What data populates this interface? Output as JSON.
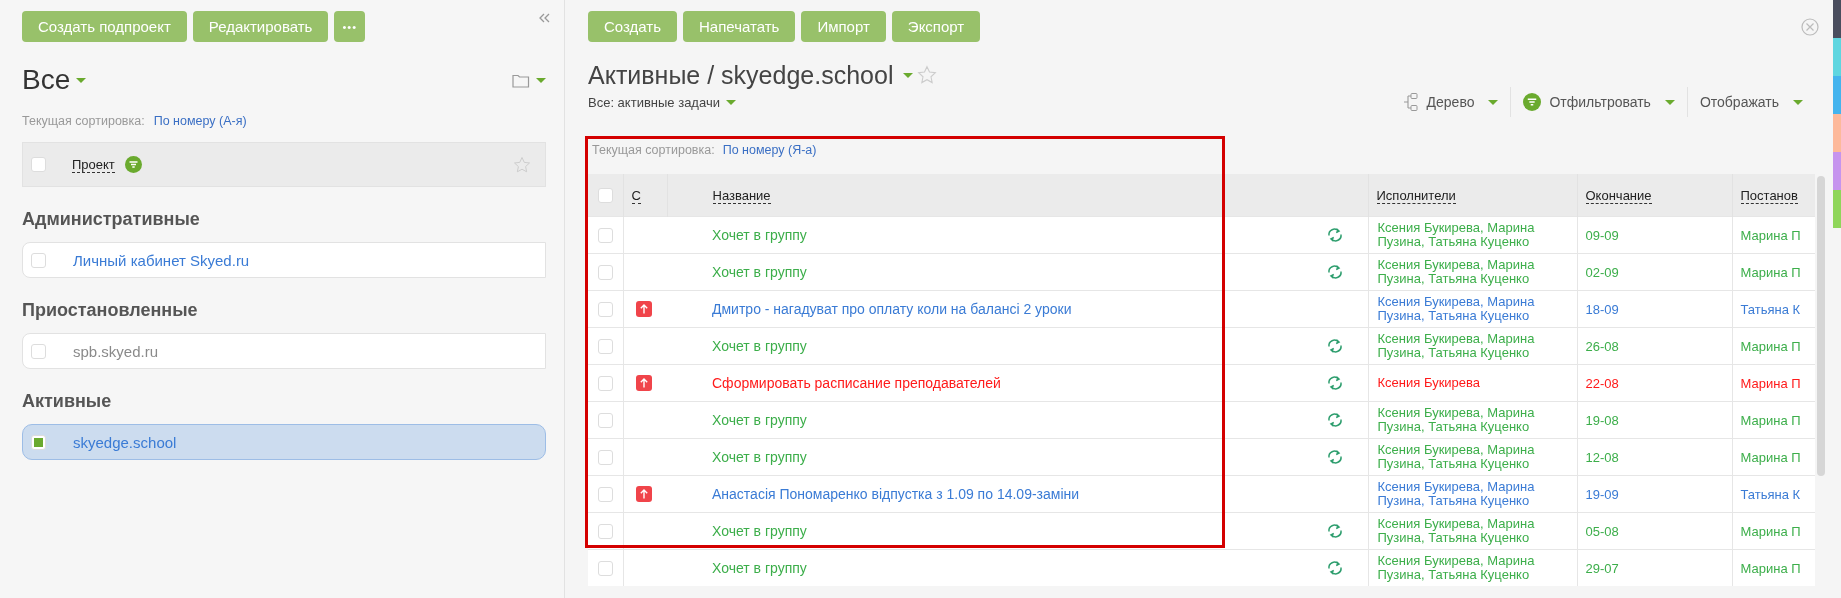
{
  "sidebar": {
    "buttons": [
      {
        "label": "Создать подпроект"
      },
      {
        "label": "Редактировать"
      }
    ],
    "more_button": "•••",
    "title": "Все",
    "sort_label": "Текущая сортировка:",
    "sort_value": "По номеру (А-я)",
    "header": {
      "label": "Проект",
      "checked": false
    },
    "sections": [
      {
        "title": "Административные",
        "items": [
          {
            "name": "Личный кабинет Skyed.ru",
            "checked": false,
            "selected": false,
            "color": "#3a7bd5"
          }
        ]
      },
      {
        "title": "Приостановленные",
        "items": [
          {
            "name": "spb.skyed.ru",
            "checked": false,
            "selected": false,
            "color": "#8a8a8a"
          }
        ]
      },
      {
        "title": "Активные",
        "items": [
          {
            "name": "skyedge.school",
            "checked": true,
            "selected": true,
            "color": "#3a7bd5"
          }
        ]
      }
    ]
  },
  "toolbar": {
    "buttons": [
      {
        "label": "Создать"
      },
      {
        "label": "Напечатать"
      },
      {
        "label": "Импорт"
      },
      {
        "label": "Экспорт"
      }
    ]
  },
  "title": "Активные / skyedge.school",
  "subtitle": "Все: активные задачи",
  "view_controls": [
    {
      "kind": "tree",
      "label": "Дерево"
    },
    {
      "kind": "filter",
      "label": "Отфильтровать"
    },
    {
      "kind": "display",
      "label": "Отображать"
    }
  ],
  "table": {
    "sort_label": "Текущая сортировка:",
    "sort_value": "По номеру (Я-а)",
    "header_checked": false,
    "columns": [
      "С",
      "Название",
      "Исполнители",
      "Окончание",
      "Постанов"
    ],
    "rows": [
      {
        "checked": false,
        "priority": false,
        "title": "Хочет в группу",
        "recurring": true,
        "assignees": "Ксения Букирева, Марина Пузина, Татьяна Куценко",
        "due": "09-09",
        "author": "Марина П",
        "color": "#3cae4a"
      },
      {
        "checked": false,
        "priority": false,
        "title": "Хочет в группу",
        "recurring": true,
        "assignees": "Ксения Букирева, Марина Пузина, Татьяна Куценко",
        "due": "02-09",
        "author": "Марина П",
        "color": "#3cae4a"
      },
      {
        "checked": false,
        "priority": true,
        "title": "Дмитро - нагадуват про оплату коли на балансі 2 уроки",
        "recurring": false,
        "assignees": "Ксения Букирева, Марина Пузина, Татьяна Куценко",
        "due": "18-09",
        "author": "Татьяна К",
        "color": "#3a7bd5"
      },
      {
        "checked": false,
        "priority": false,
        "title": "Хочет в группу",
        "recurring": true,
        "assignees": "Ксения Букирева, Марина Пузина, Татьяна Куценко",
        "due": "26-08",
        "author": "Марина П",
        "color": "#3cae4a"
      },
      {
        "checked": false,
        "priority": true,
        "title": "Сформировать расписание преподавателей",
        "recurring": true,
        "assignees": "Ксения Букирева",
        "due": "22-08",
        "author": "Марина П",
        "color": "#ff1a1a"
      },
      {
        "checked": false,
        "priority": false,
        "title": "Хочет в группу",
        "recurring": true,
        "assignees": "Ксения Букирева, Марина Пузина, Татьяна Куценко",
        "due": "19-08",
        "author": "Марина П",
        "color": "#3cae4a"
      },
      {
        "checked": false,
        "priority": false,
        "title": "Хочет в группу",
        "recurring": true,
        "assignees": "Ксения Букирева, Марина Пузина, Татьяна Куценко",
        "due": "12-08",
        "author": "Марина П",
        "color": "#3cae4a"
      },
      {
        "checked": false,
        "priority": true,
        "title": "Анастасія Пономаренко відпустка з 1.09 по 14.09-заміни",
        "recurring": false,
        "assignees": "Ксения Букирева, Марина Пузина, Татьяна Куценко",
        "due": "19-09",
        "author": "Татьяна К",
        "color": "#3a7bd5"
      },
      {
        "checked": false,
        "priority": false,
        "title": "Хочет в группу",
        "recurring": true,
        "assignees": "Ксения Букирева, Марина Пузина, Татьяна Куценко",
        "due": "05-08",
        "author": "Марина П",
        "color": "#3cae4a"
      },
      {
        "checked": false,
        "priority": false,
        "title": "Хочет в группу",
        "recurring": true,
        "assignees": "Ксения Букирева, Марина Пузина, Татьяна Куценко",
        "due": "29-07",
        "author": "Марина П",
        "color": "#3cae4a"
      }
    ]
  }
}
